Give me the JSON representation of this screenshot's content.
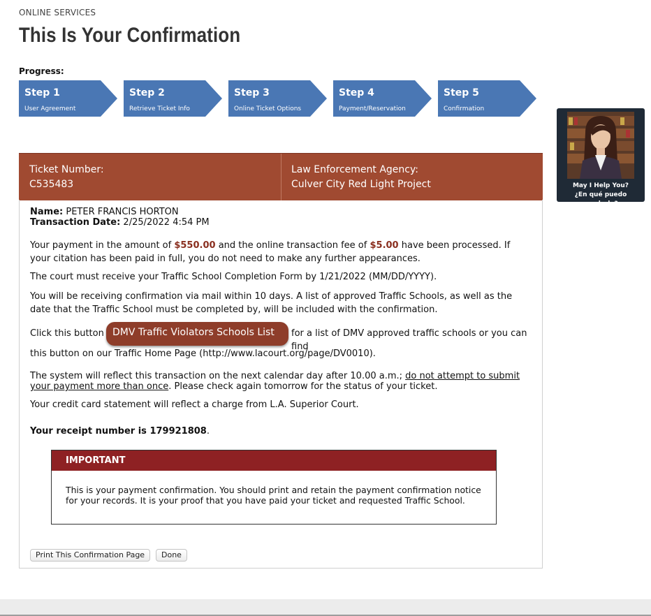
{
  "header": {
    "section_label": "ONLINE SERVICES",
    "title": "This Is Your Confirmation"
  },
  "progress": {
    "label": "Progress:",
    "steps": [
      {
        "title": "Step 1",
        "subtitle": "User Agreement"
      },
      {
        "title": "Step 2",
        "subtitle": "Retrieve Ticket Info"
      },
      {
        "title": "Step 3",
        "subtitle": "Online Ticket Options"
      },
      {
        "title": "Step 4",
        "subtitle": "Payment/Reservation"
      },
      {
        "title": "Step 5",
        "subtitle": "Confirmation"
      }
    ]
  },
  "helper": {
    "line1": "May I Help You?",
    "line2": "¿En qué puedo ayudarle?"
  },
  "ticket": {
    "number_label": "Ticket Number:",
    "number_value": "C535483",
    "agency_label": "Law Enforcement Agency:",
    "agency_value": "Culver City Red Light Project"
  },
  "details": {
    "name_label": "Name:",
    "name_value": "PETER FRANCIS HORTON",
    "date_label": "Transaction Date:",
    "date_value": "2/25/2022 4:54 PM"
  },
  "payment": {
    "prefix": "Your payment in the amount of ",
    "amount": "$550.00",
    "middle": " and the online transaction fee of ",
    "fee": "$5.00",
    "suffix": " have been processed. If your citation has been paid in full, you do not need to make any further appearances."
  },
  "messages": {
    "court": "The court must receive your Traffic School Completion Form by 1/21/2022 (MM/DD/YYYY).",
    "mail": "You will be receiving confirmation via mail within 10 days. A list of approved Traffic Schools, as well as the date that the Traffic School must be completed by, will be included with the confirmation.",
    "click_prefix": "Click this button",
    "click_suffix": "for a list of DMV approved traffic schools or you can find",
    "click_line2": "this button on our Traffic Home Page (http://www.lacourt.org/page/DV0010).",
    "system_prefix": "The system will reflect this transaction on the next calendar day after 10.00 a.m.; ",
    "system_underline": "do not attempt to submit your payment more than once",
    "system_suffix": ". Please check again tomorrow for the status of your ticket.",
    "credit": "Your credit card statement will reflect a charge from L.A. Superior Court.",
    "receipt_label": "Your receipt number is ",
    "receipt_number": "179921808",
    "receipt_end": "."
  },
  "dmv_button_label": "DMV Traffic Violators Schools List",
  "important": {
    "heading": "IMPORTANT",
    "body": "This is your payment confirmation. You should print and retain the payment confirmation notice for your records. It is your proof that you have paid your ticket and requested Traffic School."
  },
  "actions": {
    "print_label": "Print This Confirmation Page",
    "done_label": "Done"
  }
}
